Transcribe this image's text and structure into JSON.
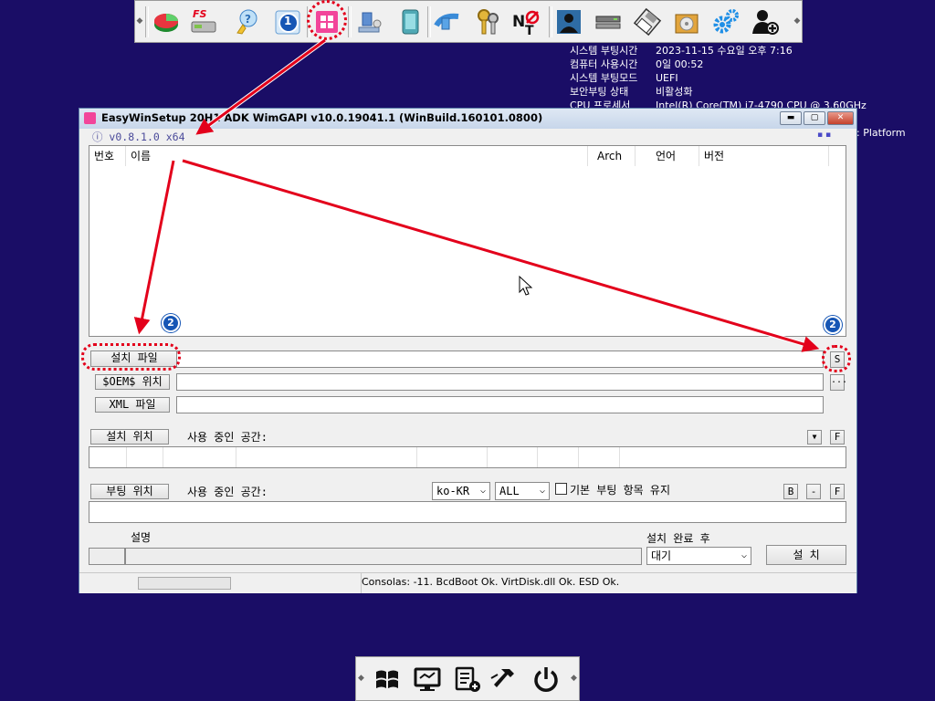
{
  "toolbar": {
    "icons": [
      "disk-partition-icon",
      "fs-tool-icon",
      "wizard-icon",
      "badge-one-icon",
      "windows-setup-icon",
      "network-icon",
      "tablet-icon",
      "connect-icon",
      "keys-icon",
      "no-t-icon",
      "user-photo-icon",
      "drive-icon",
      "floppy-icon",
      "cd-box-icon",
      "gears-icon",
      "add-user-icon"
    ]
  },
  "sysinfo": [
    {
      "k": "시스템 부팅시간",
      "v": "2023-11-15 수요일 오후 7:16"
    },
    {
      "k": "컴퓨터 사용시간",
      "v": "0일 00:52"
    },
    {
      "k": "시스템 부팅모드",
      "v": "UEFI"
    },
    {
      "k": "보안부팅 상태",
      "v": "비활성화"
    },
    {
      "k": "CPU 프로세서",
      "v": "Intel(R) Core(TM) i7-4790 CPU @ 3.60GHz"
    }
  ],
  "platform_text": ": Platform",
  "window": {
    "title": "EasyWinSetup  20H1 ADK  WimGAPI v10.0.19041.1 (WinBuild.160101.0800)",
    "version": "ⓘ v0.8.1.0 x64",
    "dots": "▪ ▪"
  },
  "list": {
    "headers": {
      "no": "번호",
      "name": "이름",
      "arch": "Arch",
      "lang": "언어",
      "ver": "버전"
    }
  },
  "buttons": {
    "setup_file": "설치 파일",
    "oem": "$OEM$ 위치",
    "xml": "XML 파일",
    "s": "S",
    "ellipsis": "...",
    "install_loc": "설치 위치",
    "boot_loc": "부팅 위치",
    "f": "F",
    "b": "B",
    "dash": "-",
    "install": "설 치"
  },
  "labels": {
    "used_space": "사용 중인 공간:",
    "keep_boot": "기본 부팅 항목 유지",
    "description": "설명",
    "after_install": "설치 완료 후"
  },
  "combos": {
    "lang": "ko-KR",
    "all": "ALL",
    "after": "대기"
  },
  "status": "Consolas: -11. BcdBoot Ok. VirtDisk.dll Ok. ESD Ok.",
  "badges": {
    "one": "1",
    "two": "2"
  },
  "bottom_icons": [
    "windows-flag-icon",
    "monitor-icon",
    "task-list-icon",
    "hammer-icon",
    "power-icon"
  ],
  "colors": {
    "desktop": "#1a0d66",
    "arrow": "#e3001b",
    "badge": "#1656b5"
  }
}
